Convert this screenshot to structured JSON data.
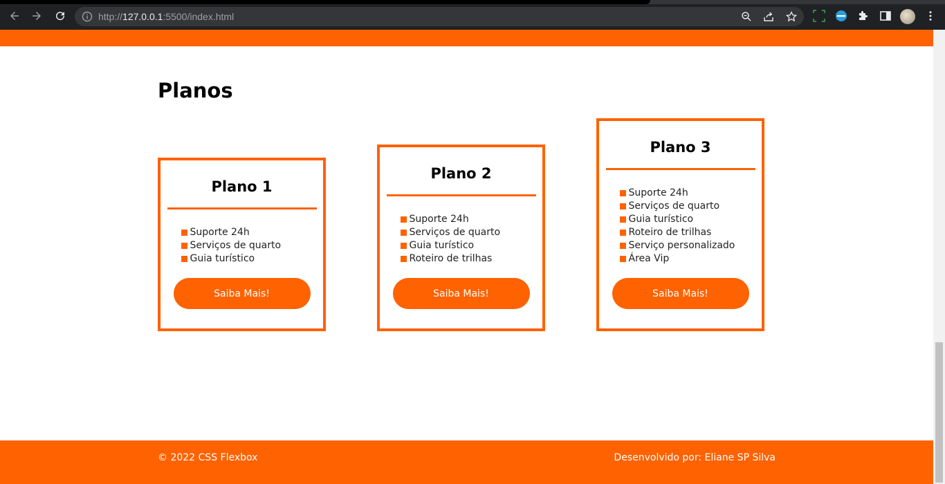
{
  "browser": {
    "url_prefix": "http://",
    "url_host": "127.0.0.1",
    "url_path": ":5500/index.html"
  },
  "page": {
    "section_title": "Planos",
    "plans": [
      {
        "title": "Plano 1",
        "features": [
          "Suporte 24h",
          "Serviços de quarto",
          "Guia turístico"
        ],
        "button_label": "Saiba Mais!"
      },
      {
        "title": "Plano 2",
        "features": [
          "Suporte 24h",
          "Serviços de quarto",
          "Guia turístico",
          "Roteiro de trilhas"
        ],
        "button_label": "Saiba Mais!"
      },
      {
        "title": "Plano 3",
        "features": [
          "Suporte 24h",
          "Serviços de quarto",
          "Guia turístico",
          "Roteiro de trilhas",
          "Serviço personalizado",
          "Área Vip"
        ],
        "button_label": "Saiba Mais!"
      }
    ],
    "footer": {
      "copyright": "© 2022 CSS Flexbox",
      "credit": "Desenvolvido por: Eliane SP Silva"
    }
  },
  "colors": {
    "accent": "#ff6200",
    "chrome_bg": "#202124"
  }
}
